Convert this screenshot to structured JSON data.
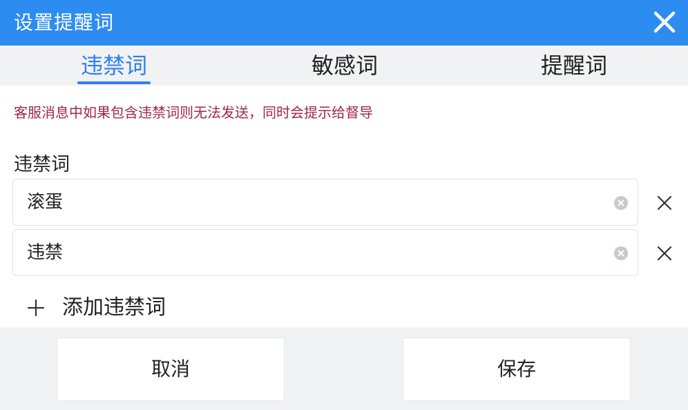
{
  "dialog": {
    "title": "设置提醒词",
    "close_icon": "close-icon"
  },
  "tabs": [
    {
      "label": "违禁词",
      "active": true
    },
    {
      "label": "敏感词",
      "active": false
    },
    {
      "label": "提醒词",
      "active": false
    }
  ],
  "hint": "客服消息中如果包含违禁词则无法发送，同时会提示给督导",
  "section_label": "违禁词",
  "words": [
    {
      "value": "滚蛋"
    },
    {
      "value": "违禁"
    }
  ],
  "add_label": "添加违禁词",
  "footer": {
    "cancel_label": "取消",
    "save_label": "保存"
  },
  "colors": {
    "title_bar": "#2d8cf0",
    "active_tab": "#2d7ff0",
    "hint_text": "#a0264a",
    "panel_bg": "#f1f2f4"
  }
}
